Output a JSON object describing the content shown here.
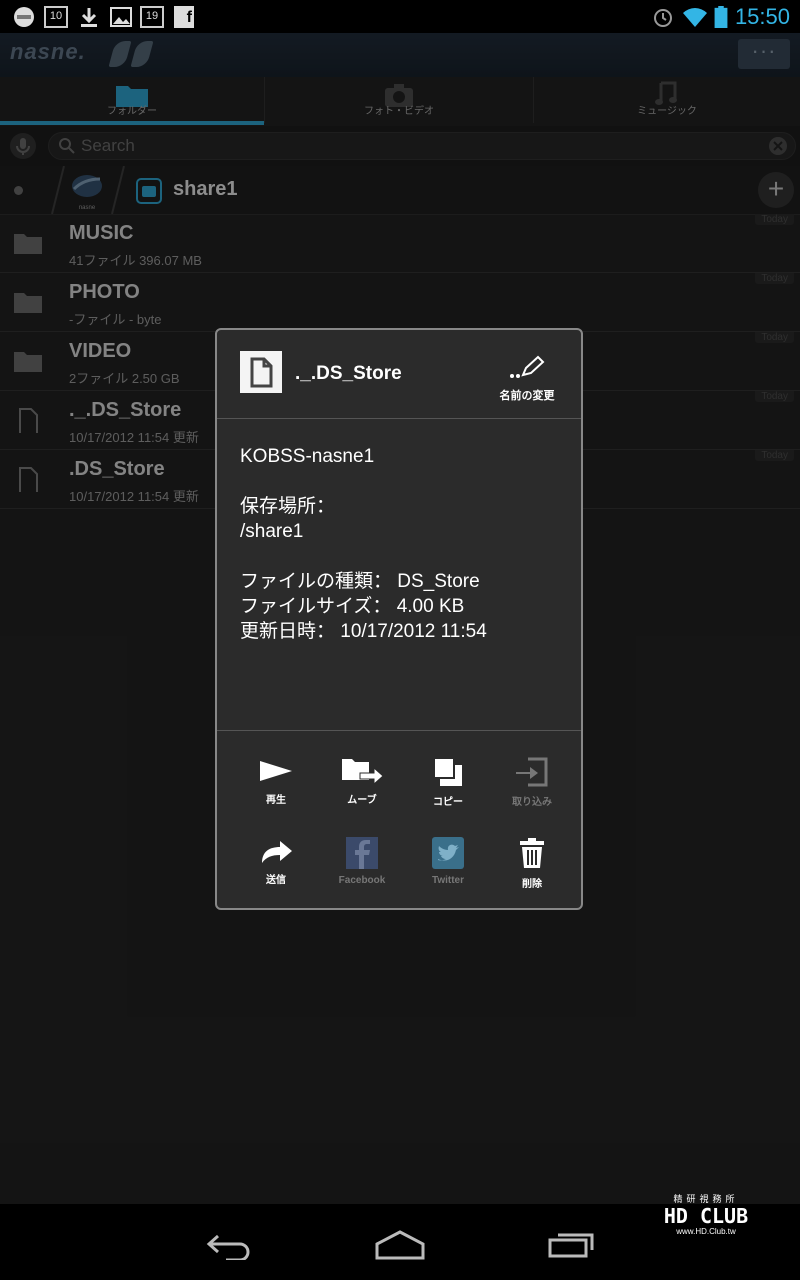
{
  "status_bar": {
    "time": "15:50",
    "calendar1": "10",
    "calendar2": "19"
  },
  "app_bar": {
    "logo": "nasne.",
    "overflow": "···"
  },
  "tabs": [
    {
      "label": "フォルダー",
      "selected": true
    },
    {
      "label": "フォト・ビデオ",
      "selected": false
    },
    {
      "label": "ミュージック",
      "selected": false
    }
  ],
  "search": {
    "placeholder": "Search"
  },
  "breadcrumb": {
    "device": "nasne",
    "current": "share1"
  },
  "files": [
    {
      "name": "MUSIC",
      "meta": "41ファイル   396.07 MB",
      "type": "folder",
      "badge": "Today"
    },
    {
      "name": "PHOTO",
      "meta": "-ファイル   - byte",
      "type": "folder",
      "badge": "Today"
    },
    {
      "name": "VIDEO",
      "meta": "2ファイル   2.50 GB",
      "type": "folder",
      "badge": "Today"
    },
    {
      "name": "._.DS_Store",
      "meta": "10/17/2012 11:54 更新",
      "type": "file",
      "badge": "Today"
    },
    {
      "name": ".DS_Store",
      "meta": "10/17/2012 11:54 更新",
      "type": "file",
      "badge": "Today"
    }
  ],
  "dialog": {
    "title": "._.DS_Store",
    "rename_label": "名前の変更",
    "device": "KOBSS-nasne1",
    "location_label": "保存場所：",
    "location": "/share1",
    "type_line": "ファイルの種類： DS_Store",
    "size_line": "ファイルサイズ： 4.00 KB",
    "date_line": "更新日時： 10/17/2012 11:54",
    "actions": {
      "play": "再生",
      "move": "ムーブ",
      "copy": "コピー",
      "import": "取り込み",
      "send": "送信",
      "facebook": "Facebook",
      "twitter": "Twitter",
      "delete": "削除"
    }
  },
  "watermark": {
    "title": "HD CLUB",
    "sub": "www.HD.Club.tw",
    "top": "精研視務所"
  },
  "colors": {
    "accent": "#33b5e5",
    "background": "#262626",
    "dialog": "#2b2b2b"
  }
}
